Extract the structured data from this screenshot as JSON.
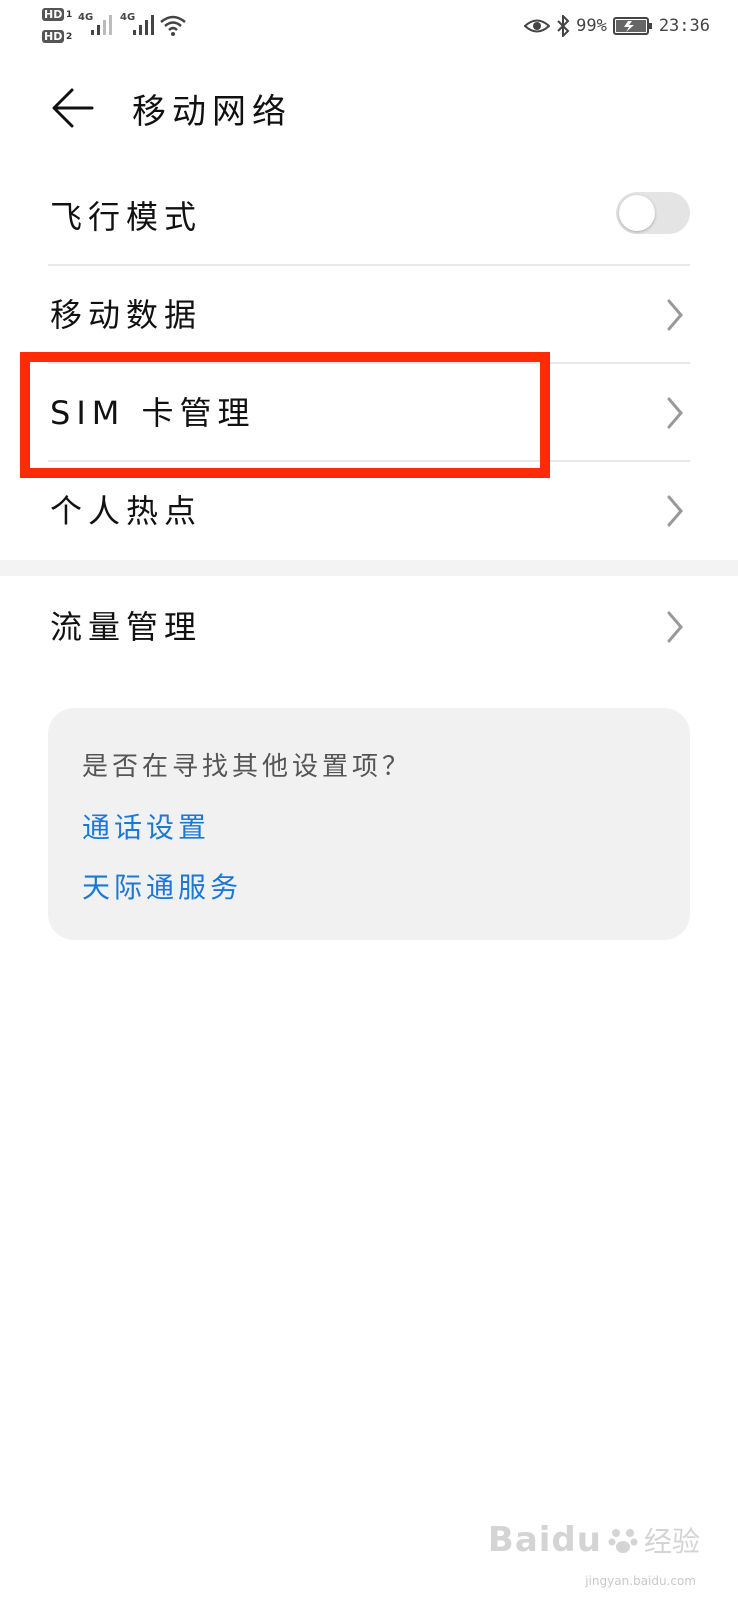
{
  "status_bar": {
    "hd1": "HD",
    "hd1_num": "1",
    "hd2": "HD",
    "hd2_num": "2",
    "net1": "4G",
    "net2": "4G",
    "battery_percent": "99%",
    "time": "23:36"
  },
  "header": {
    "title": "移动网络"
  },
  "settings": {
    "airplane_mode": {
      "label": "飞行模式",
      "enabled": false
    },
    "mobile_data": {
      "label": "移动数据"
    },
    "sim_management": {
      "label": "SIM 卡管理"
    },
    "hotspot": {
      "label": "个人热点"
    },
    "data_usage": {
      "label": "流量管理"
    }
  },
  "suggestions": {
    "question": "是否在寻找其他设置项？",
    "links": [
      "通话设置",
      "天际通服务"
    ]
  },
  "watermark": {
    "brand": "Baidu",
    "cn": "经验",
    "url": "jingyan.baidu.com"
  },
  "colors": {
    "highlight": "#ff2a06",
    "link": "#1a78d6"
  }
}
